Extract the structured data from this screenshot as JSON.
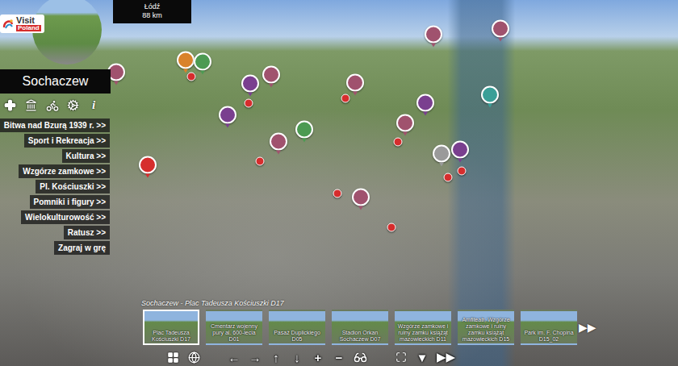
{
  "logo": {
    "line1": "Visit",
    "line2": "Poland"
  },
  "compass": {
    "place": "Łódź",
    "distance": "88 km"
  },
  "title": "Sochaczew",
  "info_icon": "i",
  "menu": [
    {
      "label": "Bitwa nad Bzurą 1939 r. >>"
    },
    {
      "label": "Sport i Rekreacja >>"
    },
    {
      "label": "Kultura >>"
    },
    {
      "label": "Wzgórze zamkowe >>"
    },
    {
      "label": "Pl. Kościuszki >>"
    },
    {
      "label": "Pomniki i figury >>"
    },
    {
      "label": "Wielokulturowość >>"
    },
    {
      "label": "Ratusz >>"
    },
    {
      "label": "Zagraj w grę"
    }
  ],
  "caption": "Sochaczew - Plac Tadeusza Kościuszki D17",
  "thumbnails": [
    {
      "label": "Plac Tadeusza Kościuszki D17",
      "selected": true
    },
    {
      "label": "Cmentarz wojenny pury al. 600-lecia D01",
      "selected": false
    },
    {
      "label": "Pasaż Duplickiego D05",
      "selected": false
    },
    {
      "label": "Stadion Orkan Sochaczew D07",
      "selected": false
    },
    {
      "label": "Wzgórze zamkowe i ruiny zamku książąt mazowieckich D11",
      "selected": false
    },
    {
      "label": "Amfiteatr, Wzgórze zamkowe i ruiny zamku książąt mazowieckich D15",
      "selected": false
    },
    {
      "label": "Park im. F. Chopina D15_02",
      "selected": false
    }
  ],
  "strip_next": "▶▶",
  "toolbar": {
    "nav": [
      "←",
      "→",
      "↑",
      "↓",
      "+",
      "−"
    ],
    "end": [
      "▼",
      "▶▶"
    ]
  },
  "pins": [
    {
      "kind": "large",
      "color": "#a0526e"
    },
    {
      "kind": "large",
      "color": "#d9822b"
    },
    {
      "kind": "large",
      "color": "#4c9a52"
    },
    {
      "kind": "small",
      "color": "#d62d2d"
    },
    {
      "kind": "large",
      "color": "#7a3f8f"
    },
    {
      "kind": "large",
      "color": "#a0526e"
    },
    {
      "kind": "small",
      "color": "#d62d2d"
    },
    {
      "kind": "large",
      "color": "#a0526e"
    },
    {
      "kind": "small",
      "color": "#d62d2d"
    },
    {
      "kind": "large",
      "color": "#a0526e"
    },
    {
      "kind": "large",
      "color": "#a0526e"
    },
    {
      "kind": "large",
      "color": "#7a3f8f"
    },
    {
      "kind": "large",
      "color": "#3a9f97"
    },
    {
      "kind": "large",
      "color": "#a0526e"
    },
    {
      "kind": "large",
      "color": "#9a9a9a"
    },
    {
      "kind": "large",
      "color": "#7a3f8f"
    },
    {
      "kind": "small",
      "color": "#d62d2d"
    },
    {
      "kind": "small",
      "color": "#d62d2d"
    },
    {
      "kind": "small",
      "color": "#d62d2d"
    },
    {
      "kind": "large",
      "color": "#a0526e"
    },
    {
      "kind": "large",
      "color": "#4c9a52"
    },
    {
      "kind": "large",
      "color": "#7a3f8f"
    },
    {
      "kind": "large",
      "color": "#d62d2d"
    },
    {
      "kind": "small",
      "color": "#d62d2d"
    },
    {
      "kind": "small",
      "color": "#d62d2d"
    },
    {
      "kind": "large",
      "color": "#a0526e"
    },
    {
      "kind": "small",
      "color": "#d62d2d"
    }
  ]
}
